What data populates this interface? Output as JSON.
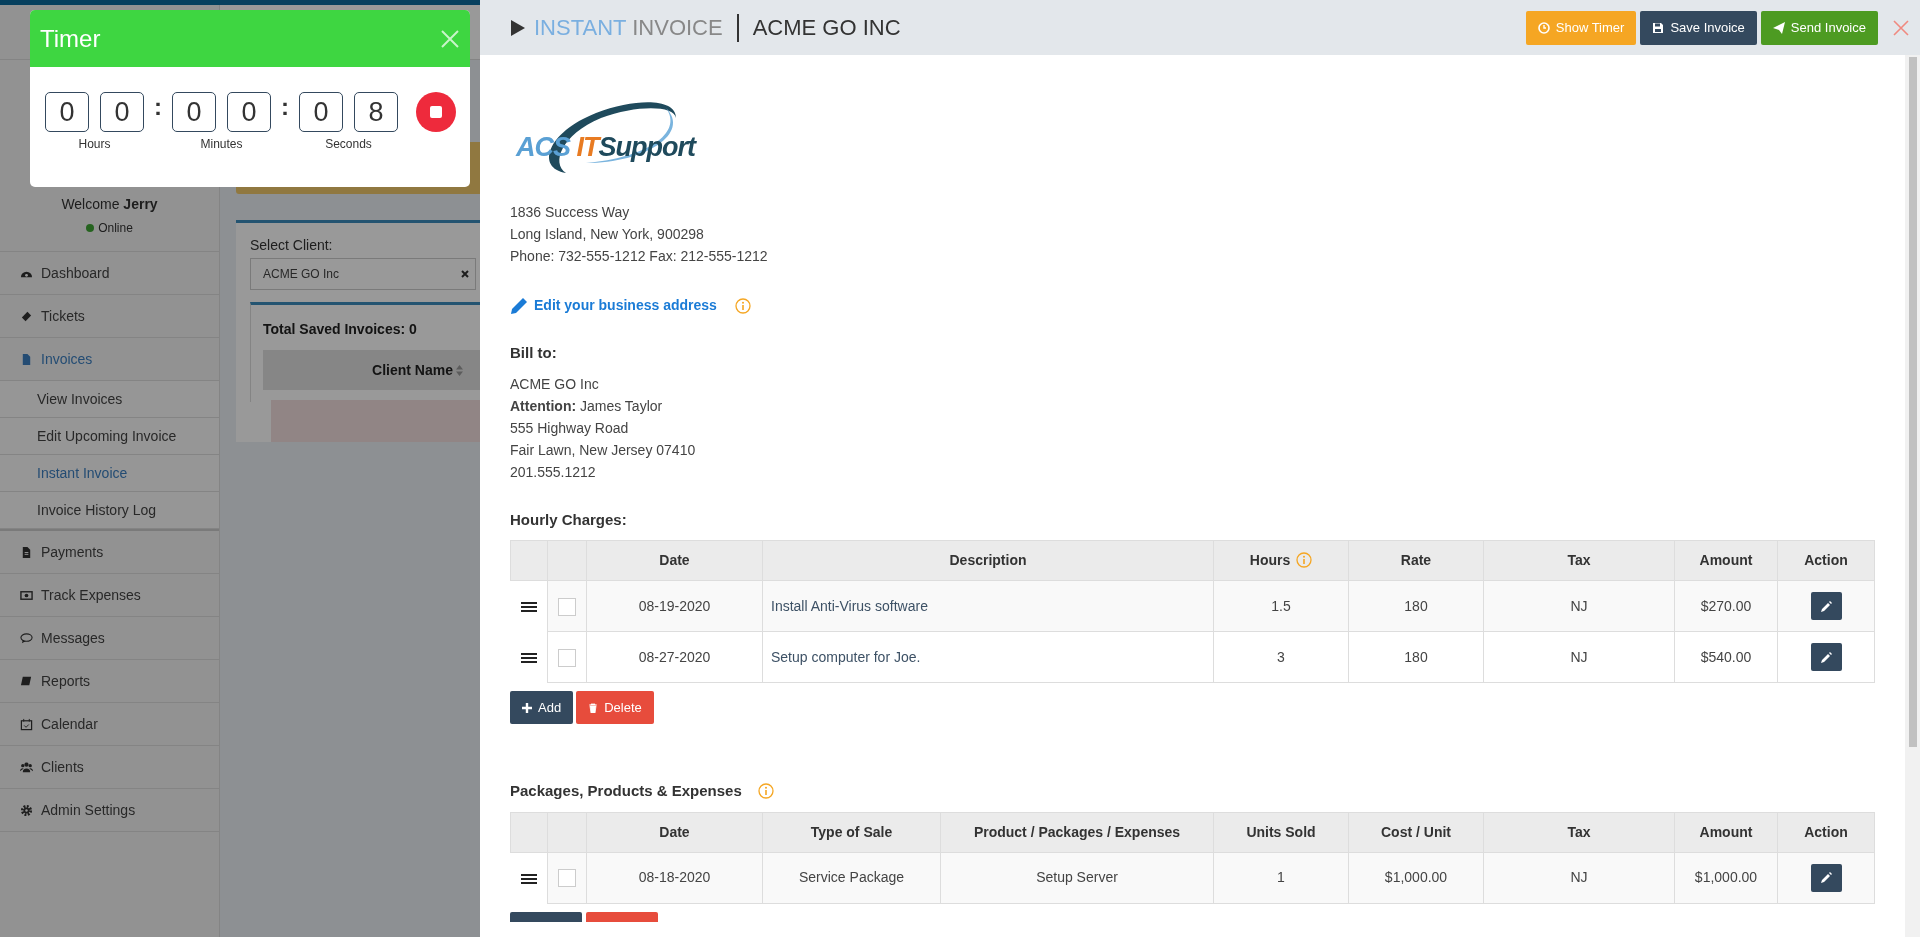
{
  "background_page": {
    "sidebar": {
      "welcome": "Welcome **Jerry**",
      "status": "Online",
      "online": true,
      "items": [
        {
          "label": "Dashboard",
          "selected": false
        },
        {
          "label": "Tickets",
          "selected": false
        },
        {
          "label": "Invoices",
          "selected": true,
          "children": [
            {
              "label": "View Invoices",
              "selected": false
            },
            {
              "label": "Edit Upcoming Invoice",
              "selected": false
            },
            {
              "label": "Instant Invoice",
              "selected": true
            },
            {
              "label": "Invoice History Log",
              "selected": false
            }
          ]
        },
        {
          "label": "Payments",
          "selected": false
        },
        {
          "label": "Track Expenses",
          "selected": false
        },
        {
          "label": "Messages",
          "selected": false
        },
        {
          "label": "Reports",
          "selected": false
        },
        {
          "label": "Calendar",
          "selected": false
        },
        {
          "label": "Clients",
          "selected": false
        },
        {
          "label": "Admin Settings",
          "selected": false
        }
      ]
    },
    "main": {
      "select_label": "Select Client:",
      "select_value": "ACME GO Inc",
      "total_saved": "Total Saved Invoices: 0",
      "columns": [
        "Client Name"
      ]
    }
  },
  "timer": {
    "title": "Timer",
    "digits": [
      "0",
      "0",
      "0",
      "0",
      "0",
      "8"
    ],
    "separators": [
      ":",
      ":"
    ],
    "units": [
      "Hours",
      "Minutes",
      "Seconds"
    ],
    "running": true
  },
  "panel": {
    "title_accent": "INSTANT",
    "title": "INVOICE",
    "client": "ACME GO INC",
    "buttons": [
      {
        "label": "Show Timer",
        "kind": "timer"
      },
      {
        "label": "Save Invoice",
        "kind": "save"
      },
      {
        "label": "Send Invoice",
        "kind": "send"
      }
    ]
  },
  "business": {
    "logo": [
      "ACS",
      "IT",
      "Support"
    ],
    "address": [
      "1836 Success Way",
      "Long Island, New York, 900298",
      "Phone: 732-555-1212 Fax: 212-555-1212"
    ],
    "edit_link": "Edit your business address"
  },
  "bill_to": {
    "heading": "Bill to:",
    "lines": [
      "ACME GO Inc",
      "**Attention:** James Taylor",
      "555 Highway Road",
      "Fair Lawn, New Jersey 07410",
      "201.555.1212"
    ]
  },
  "hourly_charges": {
    "heading": "Hourly Charges:",
    "columns": [
      {
        "label": "Date"
      },
      {
        "label": "Description"
      },
      {
        "label": "Hours",
        "info": true
      },
      {
        "label": "Rate"
      },
      {
        "label": "Tax"
      },
      {
        "label": "Amount"
      },
      {
        "label": "Action"
      }
    ],
    "rows": [
      {
        "checked": false,
        "cells": [
          "08-19-2020",
          "Install Anti-Virus software",
          "1.5",
          "180",
          "NJ",
          "$270.00"
        ]
      },
      {
        "checked": false,
        "cells": [
          "08-27-2020",
          "Setup computer for Joe.",
          "3",
          "180",
          "NJ",
          "$540.00"
        ]
      }
    ],
    "buttons": [
      {
        "label": "Add",
        "kind": "add"
      },
      {
        "label": "Delete",
        "kind": "delete"
      }
    ]
  },
  "packages": {
    "heading": "Packages, Products & Expenses",
    "info": true,
    "columns": [
      {
        "label": "Date"
      },
      {
        "label": "Type of Sale"
      },
      {
        "label": "Product / Packages / Expenses"
      },
      {
        "label": "Units Sold"
      },
      {
        "label": "Cost / Unit"
      },
      {
        "label": "Tax"
      },
      {
        "label": "Amount"
      },
      {
        "label": "Action"
      }
    ],
    "rows": [
      {
        "checked": false,
        "cells": [
          "08-18-2020",
          "Service Package",
          "Setup Server",
          "1",
          "$1,000.00",
          "NJ",
          "$1,000.00"
        ]
      }
    ]
  }
}
